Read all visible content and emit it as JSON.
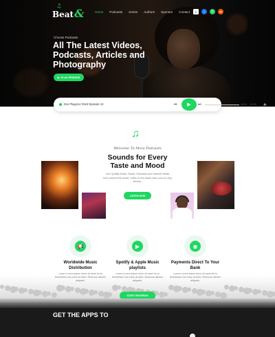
{
  "brand": {
    "name": "Beat",
    "accent": "&"
  },
  "nav": {
    "items": [
      "Home",
      "Podcasts",
      "Series",
      "Authors",
      "Sponsor",
      "Contact"
    ],
    "active_index": 0,
    "icons": [
      {
        "name": "menu-icon",
        "glyph": "≡",
        "color": "#ffffff"
      },
      {
        "name": "facebook-icon",
        "glyph": "f",
        "color": "#1877f2"
      },
      {
        "name": "whatsapp-icon",
        "glyph": "✆",
        "color": "#25d366"
      },
      {
        "name": "soundcloud-icon",
        "glyph": "☁",
        "color": "#ff5500"
      }
    ]
  },
  "hero": {
    "kicker": "Choose Podcasts",
    "title": "All The Latest Videos, Podcasts, Articles and Photography",
    "cta": "PLAY EPISODE"
  },
  "player": {
    "track": "Dvs Playproc Rsml Episode 13",
    "prev": "⏮",
    "play": "▶",
    "next": "⏭",
    "time_current": "00:00",
    "time_total": "00:00",
    "volume": "🔈"
  },
  "welcome": {
    "kicker": "Welcome To Mora Podcasts",
    "title": "Sounds for Every Taste and Mood",
    "description": "Live Quality Music, Radio, Podcasts and Internet Radio from around the world. Listen in the Audio Has Love on Any Device.",
    "cta": "LISTEN NOW"
  },
  "features": [
    {
      "icon": "megaphone-icon",
      "glyph": "📢",
      "title": "Worldwide Music Distribution",
      "description": "Lorem Lorem ipsum dolor sit amet do la fermentum non risus at enim. Rhoncus ultrices aliquam."
    },
    {
      "icon": "playlist-icon",
      "glyph": "▶",
      "title": "Spotify & Apple Music playlists",
      "description": "Lorem Lorem ipsum dolor sit amet do la fermentum non risus at enim. Rhoncus ultrices aliquam."
    },
    {
      "icon": "podcast-icon",
      "glyph": "◉",
      "title": "Payments Direct To Your Bank",
      "description": "Lorem Lorem ipsum dolor sit amet do la fermentum non risus at enim. Rhoncus ultrices aliquam."
    }
  ],
  "start_cta": "START ENTERING",
  "apps": {
    "title": "GET THE APPS TO"
  },
  "colors": {
    "accent": "#1ed760",
    "dark": "#1a1a1a"
  }
}
